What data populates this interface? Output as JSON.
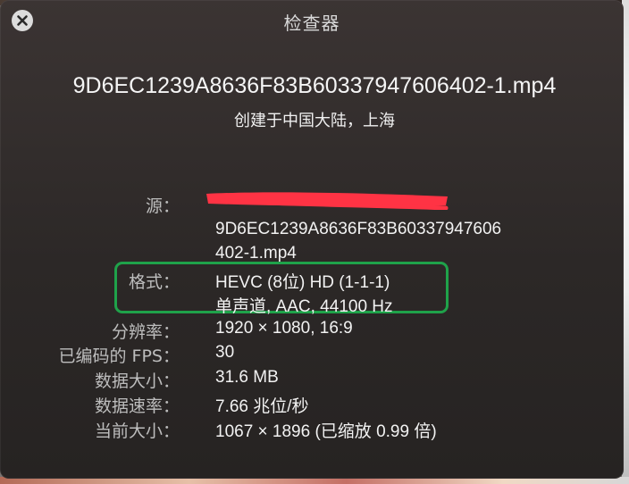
{
  "window": {
    "title": "检查器"
  },
  "file": {
    "name": "9D6EC1239A8636F83B60337947606402-1.mp4",
    "created": "创建于中国大陆，上海"
  },
  "info": {
    "source_label": "源：",
    "source_value_line1": "9D6EC1239A8636F83B60337947606",
    "source_value_line2": "402-1.mp4",
    "format_label": "格式：",
    "format_line1": "HEVC (8位) HD (1-1-1)",
    "format_line2": "单声道, AAC, 44100 Hz",
    "resolution_label": "分辨率：",
    "resolution_value": "1920 × 1080, 16:9",
    "fps_label": "已编码的 FPS：",
    "fps_value": "30",
    "size_label": "数据大小：",
    "size_value": "31.6 MB",
    "rate_label": "数据速率：",
    "rate_value": "7.66 兆位/秒",
    "current_size_label": "当前大小：",
    "current_size_value": "1067 × 1896 (已缩放 0.99 倍)"
  },
  "colors": {
    "highlight_border": "#1fa24a",
    "redaction": "#ff3344"
  },
  "icons": {
    "close": "close-icon"
  }
}
